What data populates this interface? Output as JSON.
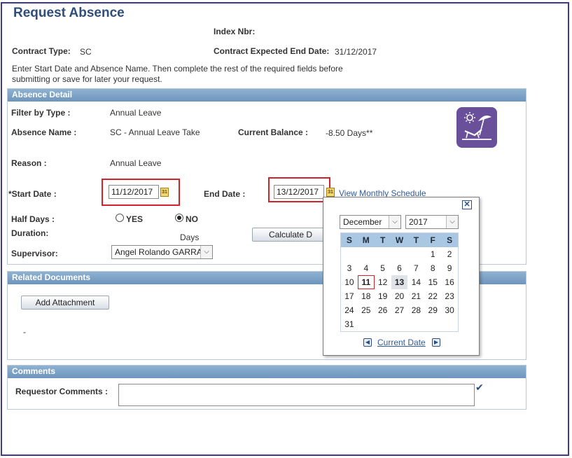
{
  "page": {
    "title": "Request Absence",
    "index_nbr_label": "Index Nbr:",
    "contract_type_label": "Contract Type:",
    "contract_type_value": "SC",
    "contract_end_label": "Contract Expected End Date:",
    "contract_end_value": "31/12/2017",
    "instructions": "Enter Start Date and Absence Name. Then complete the rest of the required fields before",
    "instructions_line2": "submitting or save for later your request."
  },
  "absence_detail": {
    "header": "Absence Detail",
    "filter_label": "Filter by Type :",
    "filter_value": "Annual Leave",
    "absence_name_label": "Absence Name :",
    "absence_name_value": "SC - Annual Leave Take",
    "current_balance_label": "Current Balance :",
    "current_balance_value": "-8.50 Days**",
    "reason_label": "Reason :",
    "reason_value": "Annual Leave",
    "start_date_label": "*Start Date :",
    "start_date_value": "11/12/2017",
    "end_date_label": "End Date :",
    "end_date_value": "13/12/2017",
    "view_schedule_link": "View Monthly Schedule",
    "half_days_label": "Half Days :",
    "half_days_yes": "YES",
    "half_days_no": "NO",
    "half_days_selected": "NO",
    "duration_label": "Duration:",
    "duration_unit": "Days",
    "calculate_button": "Calculate D",
    "supervisor_label": "Supervisor:",
    "supervisor_value": "Angel Rolando GARRA",
    "calendar_icon_text": "31",
    "beach_icon": "beach-chair-sun-icon"
  },
  "calendar": {
    "month": "December",
    "year": "2017",
    "day_headers": [
      "S",
      "M",
      "T",
      "W",
      "T",
      "F",
      "S"
    ],
    "weeks": [
      [
        "",
        "",
        "",
        "",
        "",
        "1",
        "2"
      ],
      [
        "3",
        "4",
        "5",
        "6",
        "7",
        "8",
        "9"
      ],
      [
        "10",
        "11",
        "12",
        "13",
        "14",
        "15",
        "16"
      ],
      [
        "17",
        "18",
        "19",
        "20",
        "21",
        "22",
        "23"
      ],
      [
        "24",
        "25",
        "26",
        "27",
        "28",
        "29",
        "30"
      ],
      [
        "31",
        "",
        "",
        "",
        "",
        "",
        ""
      ]
    ],
    "selected_day": "11",
    "highlighted_day": "13",
    "current_date_link": "Current Date",
    "close_icon": "close-icon"
  },
  "related_documents": {
    "header": "Related Documents",
    "add_attachment_button": "Add Attachment",
    "placeholder_text": "-"
  },
  "comments": {
    "header": "Comments",
    "requestor_label": "Requestor Comments :",
    "requestor_value": "",
    "spellcheck_icon": "spellcheck-icon"
  },
  "colors": {
    "title": "#2f4f7a",
    "section_header": "#7aa0c6",
    "highlight_box": "#d3232a",
    "frame_border": "#3d3a8e",
    "beach_icon_bg": "#6a4f9b"
  }
}
